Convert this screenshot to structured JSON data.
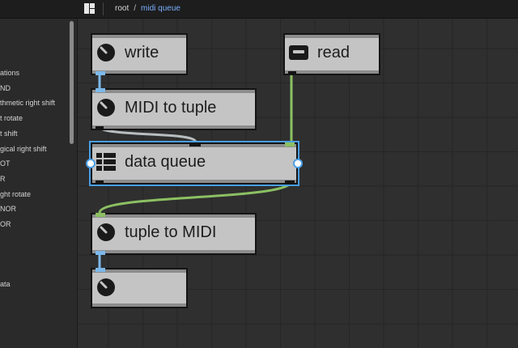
{
  "breadcrumb": {
    "root": "root",
    "separator": "/",
    "current": "midi queue"
  },
  "sidebar": {
    "items": [
      "ations",
      "ND",
      "thmetic right shift",
      "t rotate",
      "t shift",
      "gical right shift",
      "OT",
      "R",
      "ght rotate",
      "NOR",
      "OR",
      "ata"
    ]
  },
  "nodes": {
    "write": {
      "label": "write",
      "icon": "knob-icon"
    },
    "read": {
      "label": "read",
      "icon": "slot-icon"
    },
    "midi_to_tuple": {
      "label": "MIDI to tuple",
      "icon": "knob-icon"
    },
    "data_queue": {
      "label": "data queue",
      "icon": "table-grid-icon"
    },
    "tuple_to_midi": {
      "label": "tuple to MIDI",
      "icon": "knob-icon"
    },
    "output": {
      "label": "",
      "icon": "knob-icon"
    }
  },
  "colors": {
    "accent": "#7ab0ff",
    "selection": "#4a9fe6",
    "wire_blue": "#7cb8ea",
    "wire_green": "#8cc063",
    "wire_grey": "#b8bec0",
    "node_body": "#c4c4c4"
  }
}
